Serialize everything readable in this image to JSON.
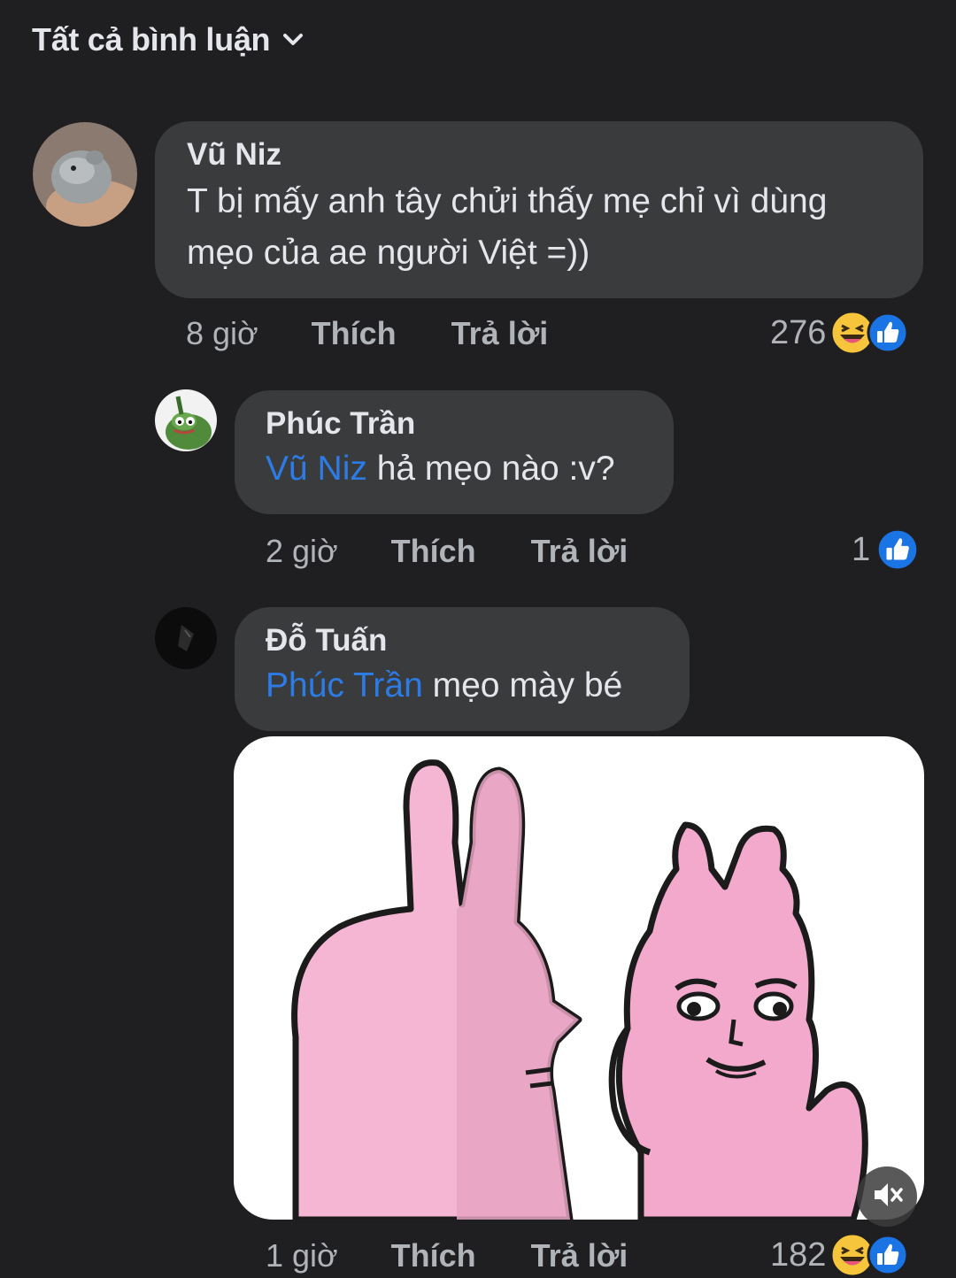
{
  "header": {
    "title": "Tất cả bình luận"
  },
  "comments": [
    {
      "author": "Vũ Niz",
      "text": "T bị mấy anh tây chửi thấy mẹ chỉ vì dùng mẹo của ae người Việt =))",
      "line1": "T bị mấy anh tây chửi thấy mẹ chỉ vì dùng",
      "line2": "mẹo của ae người Việt =))",
      "time": "8 giờ",
      "like_label": "Thích",
      "reply_label": "Trả lời",
      "reaction_count": "276",
      "reactions": [
        "haha-icon",
        "like-icon"
      ]
    }
  ],
  "replies": [
    {
      "author": "Phúc Trần",
      "mention": "Vũ Niz",
      "text": " hả mẹo nào :v?",
      "time": "2 giờ",
      "like_label": "Thích",
      "reply_label": "Trả lời",
      "reaction_count": "1",
      "reactions": [
        "like-icon"
      ]
    },
    {
      "author": "Đỗ Tuấn",
      "mention": "Phúc Trần",
      "text": " mẹo mày bé",
      "time": "1 giờ",
      "like_label": "Thích",
      "reply_label": "Trả lời",
      "reaction_count": "182",
      "reactions": [
        "haha-icon",
        "like-icon"
      ],
      "sticker": "pink-rabbits-sticker"
    }
  ],
  "colors": {
    "background": "#1f1f21",
    "bubble": "#3a3b3c",
    "mention": "#2d7be5",
    "like_blue": "#1b74e4",
    "haha_yellow": "#f7c53c"
  }
}
